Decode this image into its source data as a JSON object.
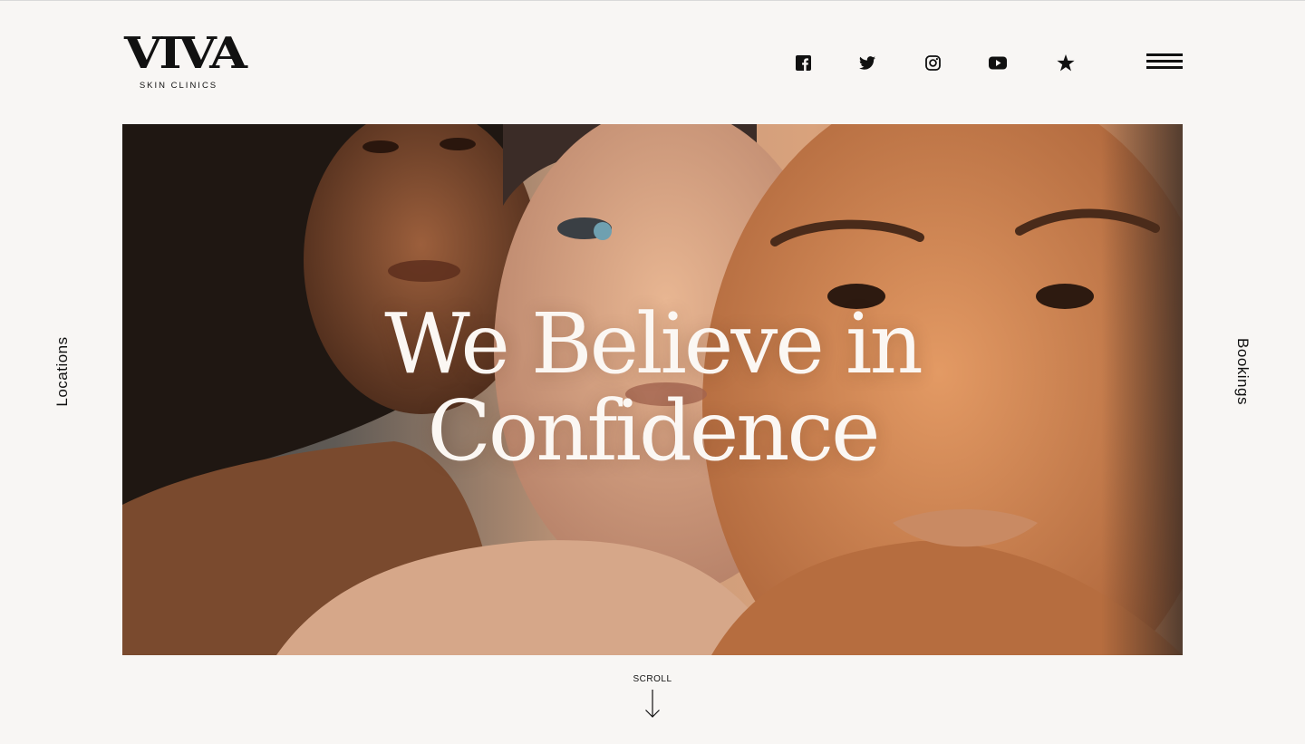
{
  "brand": {
    "name": "VIVA",
    "tagline": "SKIN CLINICS"
  },
  "header": {
    "social": [
      {
        "name": "facebook-icon"
      },
      {
        "name": "twitter-icon"
      },
      {
        "name": "instagram-icon"
      },
      {
        "name": "youtube-icon"
      },
      {
        "name": "star-icon"
      }
    ],
    "menu_icon": "hamburger-menu-icon"
  },
  "side_links": {
    "left": "Locations",
    "right": "Bookings"
  },
  "hero": {
    "headline_line1": "We Believe in",
    "headline_line2": "Confidence"
  },
  "scroll": {
    "label": "SCROLL"
  },
  "colors": {
    "background": "#f8f6f4",
    "text": "#111111",
    "headline": "#fbf7f3"
  }
}
